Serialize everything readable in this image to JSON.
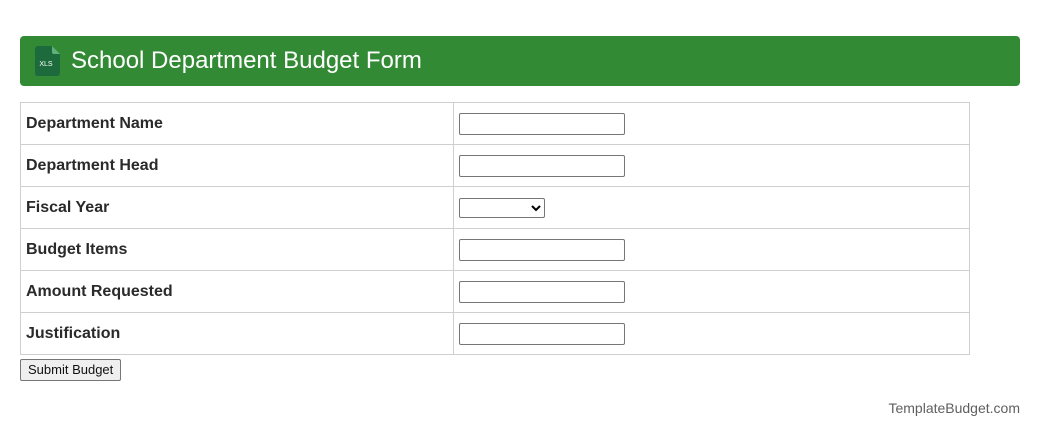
{
  "header": {
    "icon": "xls-file-icon",
    "icon_text": "XLS",
    "title": "School Department Budget Form",
    "background": "#338a35"
  },
  "form": {
    "rows": [
      {
        "label": "Department Name",
        "control": "text",
        "value": ""
      },
      {
        "label": "Department Head",
        "control": "text",
        "value": ""
      },
      {
        "label": "Fiscal Year",
        "control": "select",
        "value": ""
      },
      {
        "label": "Budget Items",
        "control": "text",
        "value": ""
      },
      {
        "label": "Amount Requested",
        "control": "text",
        "value": ""
      },
      {
        "label": "Justification",
        "control": "text",
        "value": ""
      }
    ],
    "submit_label": "Submit Budget"
  },
  "footer": {
    "credit": "TemplateBudget.com"
  }
}
